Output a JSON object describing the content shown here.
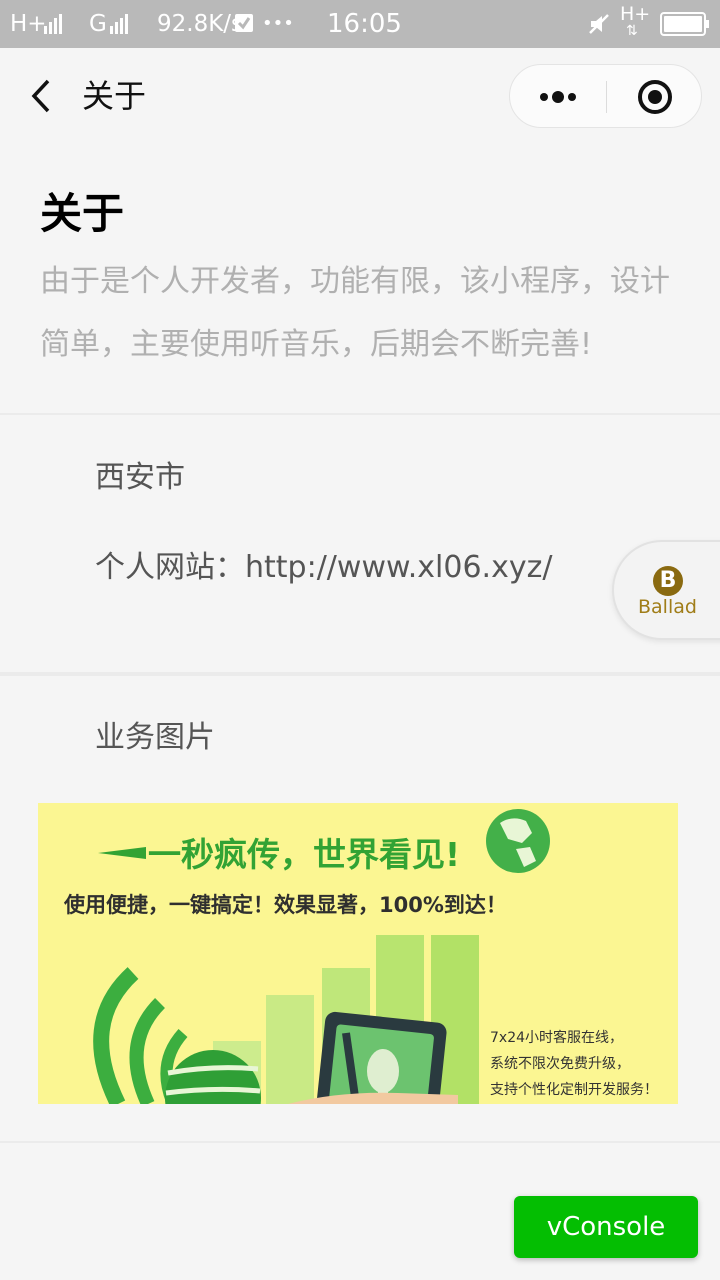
{
  "status_bar": {
    "network_1": "H+",
    "network_2": "G",
    "speed": "92.8K/s",
    "dots": "•••",
    "time": "16:05",
    "network_3": "H+"
  },
  "nav": {
    "title": "关于",
    "back_icon": "chevron-left-icon",
    "more_icon": "more-dots-icon",
    "close_icon": "target-close-icon"
  },
  "page": {
    "heading": "关于",
    "description": "由于是个人开发者，功能有限，该小程序，设计简单，主要使用听音乐，后期会不断完善!",
    "city": "西安市",
    "website": "个人网站：http://www.xl06.xyz/",
    "business_title": "业务图片"
  },
  "banner": {
    "headline": "一秒疯传，世界看见!",
    "subline": "使用便捷，一键搞定！效果显著，100%到达！",
    "lines": [
      "7x24小时客服在线，",
      "系统不限次免费升级，",
      "支持个性化定制开发服务！"
    ]
  },
  "float_button": {
    "logo_letter": "B",
    "label": "Ballad"
  },
  "vconsole": {
    "label": "vConsole"
  },
  "colors": {
    "accent_green": "#04be02",
    "banner_bg": "#fbf692",
    "banner_green": "#32a334"
  }
}
